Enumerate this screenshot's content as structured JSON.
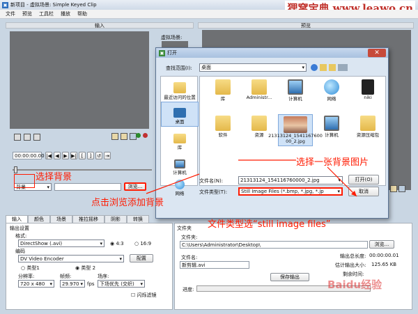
{
  "window": {
    "title": "新项目 - 虚拟场景: Simple Keyed Clip"
  },
  "menu": [
    "文件",
    "预览",
    "工具栏",
    "播放",
    "帮助"
  ],
  "watermark": "狸窝宝典 www.leawo.cn",
  "input_panel": {
    "header": "输入",
    "virtual_scene_label": "虚拟场景:",
    "timecode": "00:00:00.00",
    "background_select": "背景",
    "browse_label": "浏览..."
  },
  "preview_panel": {
    "header": "预览"
  },
  "tabs": [
    "输入",
    "颜色",
    "场景",
    "推拉摇移",
    "阴影",
    "转换"
  ],
  "output": {
    "section": "输出设置",
    "format_label": "格式:",
    "format_value": "DirectShow (.avi)",
    "aspect_43": "4:3",
    "aspect_169": "16:9",
    "codec_label": "编码",
    "codec_value": "DV Video Encoder",
    "config_label": "配置",
    "type1": "类型1",
    "type2": "类型 2",
    "resolution_label": "分辨率:",
    "resolution_value": "720 x 480",
    "framerate_label": "帧频:",
    "framerate_value": "29.970",
    "fps_unit": "fps",
    "field_label": "场序:",
    "field_value": "下场优先 (交织)",
    "interlace_label": "闪烁滤镜"
  },
  "save": {
    "folder_section": "文件夹",
    "folder_label": "文件夹:",
    "folder_path": "C:\\Users\\Administrator\\Desktop\\",
    "browse_label": "浏览...",
    "filename_label": "文件名:",
    "filename_value": "新剪辑.avi",
    "save_output": "保存输出",
    "total_length_label": "输出总长度:",
    "total_length": "00:00:00.01",
    "est_size_label": "估计输出大小:",
    "est_size": "125.65 KB",
    "remaining_label": "剩余时间:",
    "progress_label": "进度:"
  },
  "dialog": {
    "title": "打开",
    "look_in_label": "查找范围(I):",
    "look_in_value": "桌面",
    "places": [
      "最近访问的位置",
      "桌面",
      "库",
      "计算机",
      "网络"
    ],
    "files": [
      "库",
      "Administr...",
      "计算机",
      "网络",
      "niki",
      "软件",
      "资源",
      "21313124_1541167600 00_2.jpg",
      "计算机",
      "资源压缩包"
    ],
    "filename_label": "文件名(N):",
    "filename_value": "21313124_154116760000_2.jpg",
    "filetype_label": "文件类型(T):",
    "filetype_value": "Still Image Files (*.bmp, *.jpg, *.jp",
    "open_label": "打开(O)",
    "cancel_label": "取消"
  },
  "annotations": {
    "select_background": "选择背景",
    "click_browse": "点击浏览添加背景",
    "select_image": "选择一张背景图片",
    "file_type": "文件类型选“still image files”"
  },
  "baidu_watermark": "Baidu经验",
  "colors": {
    "annotation_red": "#ff1a00",
    "preview_gray": "#6e7073"
  }
}
